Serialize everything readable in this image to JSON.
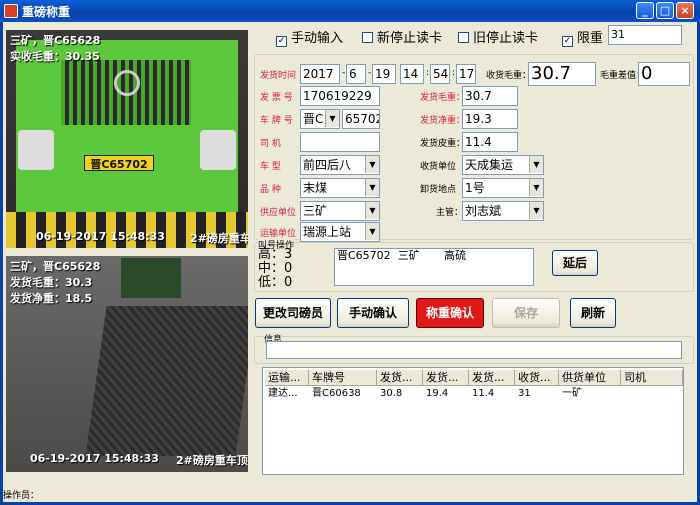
{
  "window": {
    "title": "重磅称重"
  },
  "camera1": {
    "overlay_line1": "三矿，晋C65628",
    "overlay_line2": "实收毛重：30.35",
    "plate": "晋C65702",
    "timestamp": "06-19-2017 15:48:33",
    "cam_name": "2#磅房重车"
  },
  "camera2": {
    "overlay_line1": "三矿，晋C65628",
    "overlay_line2": "发货毛重：30.3",
    "overlay_line3": "发货净重：18.5",
    "timestamp": "06-19-2017 15:48:33",
    "cam_name": "2#磅房重车顶"
  },
  "options": {
    "manual_input": "手动输入",
    "new_stop_reading": "新停止读卡",
    "old_stop_reading": "旧停止读卡",
    "limit_weight": "限重",
    "limit_value": "31"
  },
  "form": {
    "ship_time_label": "发货时间",
    "year": "2017",
    "month": "6",
    "day": "19",
    "hour": "14",
    "minute": "54",
    "second": "17",
    "receive_gross_label": "收货毛重：",
    "receive_gross_value": "30.7",
    "gross_diff_label": "毛重差值：",
    "gross_diff_value": "0",
    "invoice_label": "发 票 号",
    "invoice_value": "170619229",
    "ship_gross_label": "发货毛重：",
    "ship_gross_value": "30.7",
    "plate_label": "车 牌 号",
    "plate_prefix": "晋C",
    "plate_number": "65702",
    "ship_net_label": "发货净重：",
    "ship_net_value": "19.3",
    "driver_label": "司 机",
    "driver_value": "",
    "ship_tare_label": "发货皮重：",
    "ship_tare_value": "11.4",
    "vehicle_type_label": "车 型",
    "vehicle_type_value": "前四后八",
    "receive_unit_label": "收货单位",
    "receive_unit_value": "天成集运",
    "product_label": "品 种",
    "product_value": "末煤",
    "unload_label": "卸货地点",
    "unload_value": "1号",
    "supplier_label": "供应单位",
    "supplier_value": "三矿",
    "manager_label": "主管：",
    "manager_value": "刘志斌",
    "transport_label": "运输单位",
    "transport_value": "瑞源上站"
  },
  "queue": {
    "label": "叫号操作",
    "high_label": "高：",
    "high_value": "3",
    "mid_label": "中：",
    "mid_value": "0",
    "low_label": "低：",
    "low_value": "0",
    "current_plate": "晋C65702",
    "current_supplier": "三矿",
    "current_product": "高硫",
    "delay_button": "延后"
  },
  "actions": {
    "change_operator": "更改司磅员",
    "manual_confirm": "手动确认",
    "weigh_confirm": "称重确认",
    "save": "保存",
    "refresh": "刷新"
  },
  "info": {
    "label": "信息",
    "value": ""
  },
  "table": {
    "columns": [
      "运输...",
      "车牌号",
      "发货...",
      "发货...",
      "发货...",
      "收货...",
      "供货单位",
      "司机"
    ],
    "rows": [
      [
        "建达...",
        "晋C60638",
        "30.8",
        "19.4",
        "11.4",
        "31",
        "一矿",
        ""
      ]
    ]
  },
  "status": {
    "operator_label": "操作员：",
    "operator_value": ""
  }
}
